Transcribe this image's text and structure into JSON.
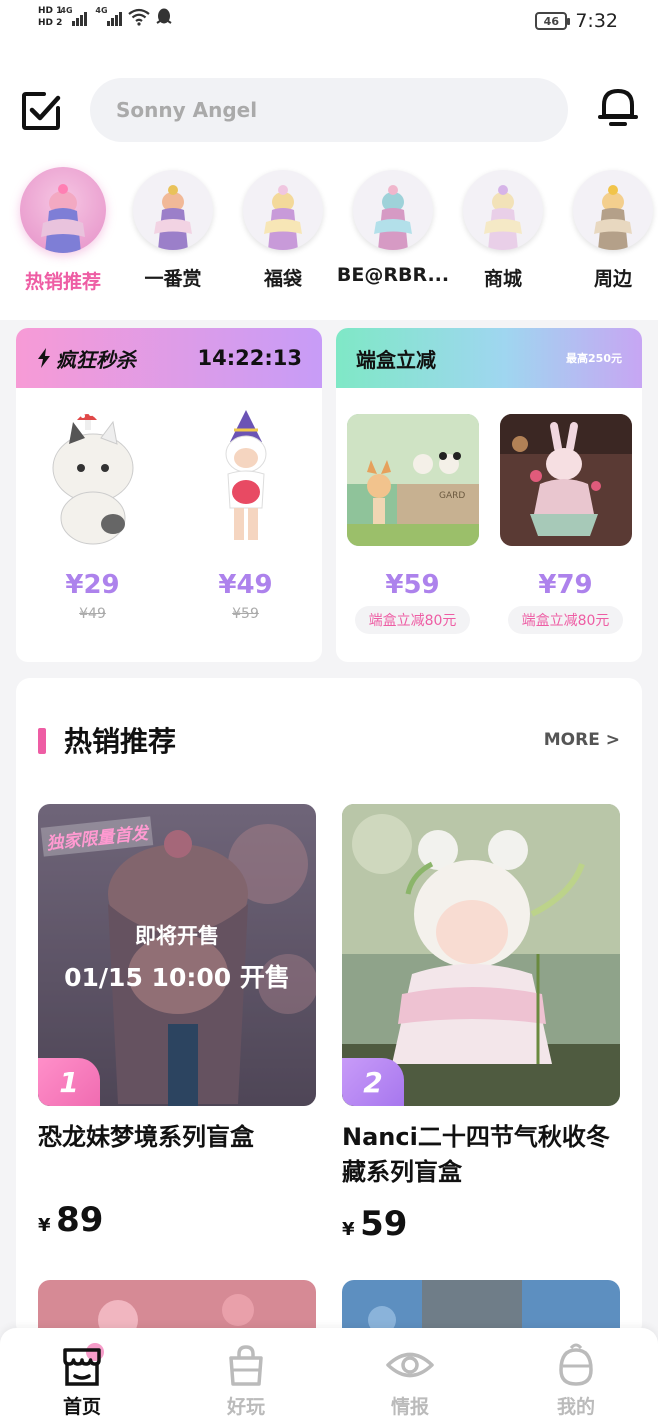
{
  "status_bar": {
    "hd1": "HD 1",
    "hd2": "HD 2",
    "net1": "4G",
    "net2": "4G",
    "battery": "46",
    "time": "7:32"
  },
  "header": {
    "search_placeholder": "Sonny Angel"
  },
  "categories": [
    {
      "label": "热销推荐",
      "active": true
    },
    {
      "label": "一番赏",
      "active": false
    },
    {
      "label": "福袋",
      "active": false
    },
    {
      "label": "BE@RBR...",
      "active": false
    },
    {
      "label": "商城",
      "active": false
    },
    {
      "label": "周边",
      "active": false
    }
  ],
  "flash_sale": {
    "title": "疯狂秒杀",
    "timer": "14:22:13",
    "items": [
      {
        "price": "¥29",
        "original": "¥49"
      },
      {
        "price": "¥49",
        "original": "¥59"
      }
    ]
  },
  "box_discount": {
    "title": "端盒立减",
    "note": "最高250元",
    "items": [
      {
        "price": "¥59",
        "badge": "端盒立减80元"
      },
      {
        "price": "¥79",
        "badge": "端盒立减80元"
      }
    ]
  },
  "hot": {
    "title": "热销推荐",
    "more": "MORE >",
    "products": [
      {
        "rank": "1",
        "name": "恐龙妹梦境系列盲盒",
        "currency": "¥",
        "price": "89",
        "exclusive": "独家限量首发",
        "status": "即将开售",
        "sale_time": "01/15 10:00 开售"
      },
      {
        "rank": "2",
        "name": "Nanci二十四节气秋收冬藏系列盲盒",
        "currency": "¥",
        "price": "59"
      }
    ]
  },
  "bottom_nav": [
    {
      "label": "首页",
      "active": true
    },
    {
      "label": "好玩",
      "active": false
    },
    {
      "label": "情报",
      "active": false
    },
    {
      "label": "我的",
      "active": false
    }
  ],
  "colors": {
    "accent_pink": "#ee5da4",
    "accent_purple": "#ad82ec"
  }
}
